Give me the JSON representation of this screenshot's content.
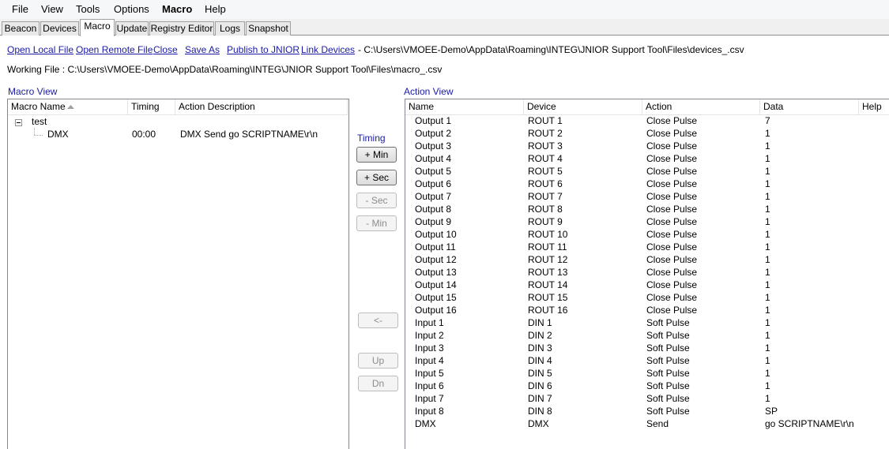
{
  "menu": [
    "File",
    "View",
    "Tools",
    "Options",
    "Macro",
    "Help"
  ],
  "tabs": [
    "Beacon",
    "Devices",
    "Macro",
    "Update",
    "Registry Editor",
    "Logs",
    "Snapshot"
  ],
  "active_tab": "Macro",
  "toolbar": {
    "links": [
      "Open Local File",
      "Open Remote File",
      "Close",
      "Save As",
      "Publish to JNIOR",
      "Link Devices"
    ],
    "devices_path": "- C:\\Users\\VMOEE-Demo\\AppData\\Roaming\\INTEG\\JNIOR Support Tool\\Files\\devices_.csv"
  },
  "working_file": "Working File : C:\\Users\\VMOEE-Demo\\AppData\\Roaming\\INTEG\\JNIOR Support Tool\\Files\\macro_.csv",
  "macro_view": {
    "label": "Macro View",
    "columns": [
      "Macro Name",
      "Timing",
      "Action Description"
    ],
    "tree": {
      "name": "test",
      "children": [
        {
          "name": "DMX",
          "timing": "00:00",
          "description": "DMX Send go SCRIPTNAME\\r\\n"
        }
      ]
    }
  },
  "timing": {
    "label": "Timing",
    "buttons": [
      "+ Min",
      "+ Sec",
      "- Sec",
      "- Min"
    ],
    "move_button": "<-",
    "up_button": "Up",
    "down_button": "Dn"
  },
  "action_view": {
    "label": "Action View",
    "columns": [
      "Name",
      "Device",
      "Action",
      "Data",
      "Help"
    ],
    "rows": [
      [
        "Output 1",
        "ROUT 1",
        "Close Pulse",
        "7"
      ],
      [
        "Output 2",
        "ROUT 2",
        "Close Pulse",
        "1"
      ],
      [
        "Output 3",
        "ROUT 3",
        "Close Pulse",
        "1"
      ],
      [
        "Output 4",
        "ROUT 4",
        "Close Pulse",
        "1"
      ],
      [
        "Output 5",
        "ROUT 5",
        "Close Pulse",
        "1"
      ],
      [
        "Output 6",
        "ROUT 6",
        "Close Pulse",
        "1"
      ],
      [
        "Output 7",
        "ROUT 7",
        "Close Pulse",
        "1"
      ],
      [
        "Output 8",
        "ROUT 8",
        "Close Pulse",
        "1"
      ],
      [
        "Output 9",
        "ROUT 9",
        "Close Pulse",
        "1"
      ],
      [
        "Output 10",
        "ROUT 10",
        "Close Pulse",
        "1"
      ],
      [
        "Output 11",
        "ROUT 11",
        "Close Pulse",
        "1"
      ],
      [
        "Output 12",
        "ROUT 12",
        "Close Pulse",
        "1"
      ],
      [
        "Output 13",
        "ROUT 13",
        "Close Pulse",
        "1"
      ],
      [
        "Output 14",
        "ROUT 14",
        "Close Pulse",
        "1"
      ],
      [
        "Output 15",
        "ROUT 15",
        "Close Pulse",
        "1"
      ],
      [
        "Output 16",
        "ROUT 16",
        "Close Pulse",
        "1"
      ],
      [
        "Input 1",
        "DIN 1",
        "Soft Pulse",
        "1"
      ],
      [
        "Input 2",
        "DIN 2",
        "Soft Pulse",
        "1"
      ],
      [
        "Input 3",
        "DIN 3",
        "Soft Pulse",
        "1"
      ],
      [
        "Input 4",
        "DIN 4",
        "Soft Pulse",
        "1"
      ],
      [
        "Input 5",
        "DIN 5",
        "Soft Pulse",
        "1"
      ],
      [
        "Input 6",
        "DIN 6",
        "Soft Pulse",
        "1"
      ],
      [
        "Input 7",
        "DIN 7",
        "Soft Pulse",
        "1"
      ],
      [
        "Input 8",
        "DIN 8",
        "Soft Pulse",
        "SP"
      ],
      [
        "DMX",
        "DMX",
        "Send",
        "go SCRIPTNAME\\r\\n"
      ]
    ]
  },
  "colors": {
    "link": "#1a1aa6",
    "menubar_bg": "#f6f7f9",
    "tabstrip_bg": "#f0f0f0",
    "panel_border": "#828790"
  }
}
